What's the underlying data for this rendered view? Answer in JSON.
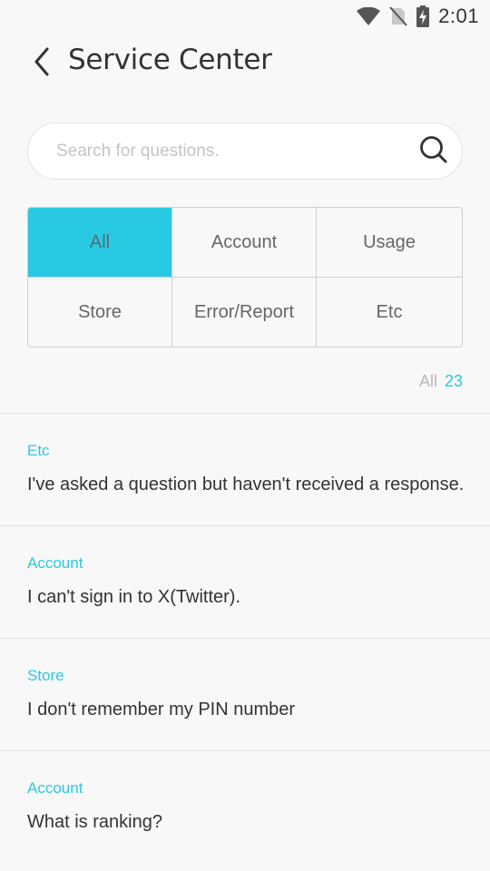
{
  "status_bar": {
    "time": "2:01",
    "icons": [
      "wifi-icon",
      "no-sim-icon",
      "battery-charging-icon"
    ]
  },
  "header": {
    "back_icon": "chevron-left-icon",
    "title": "Service Center"
  },
  "search": {
    "placeholder": "Search for questions.",
    "value": "",
    "icon": "search-icon"
  },
  "categories": {
    "selected": "All",
    "items": [
      {
        "label": "All"
      },
      {
        "label": "Account"
      },
      {
        "label": "Usage"
      },
      {
        "label": "Store"
      },
      {
        "label": "Error/Report"
      },
      {
        "label": "Etc"
      }
    ]
  },
  "count": {
    "label": "All",
    "value": "23"
  },
  "faq": [
    {
      "category": "Etc",
      "question": "I've asked a question but haven't received a response."
    },
    {
      "category": "Account",
      "question": "I can't sign in to X(Twitter)."
    },
    {
      "category": "Store",
      "question": "I don't remember my PIN number"
    },
    {
      "category": "Account",
      "question": "What is ranking?"
    }
  ],
  "colors": {
    "accent": "#29c9e3",
    "background": "#f8f8f8",
    "text": "#333333",
    "muted": "#b8b8b8"
  }
}
